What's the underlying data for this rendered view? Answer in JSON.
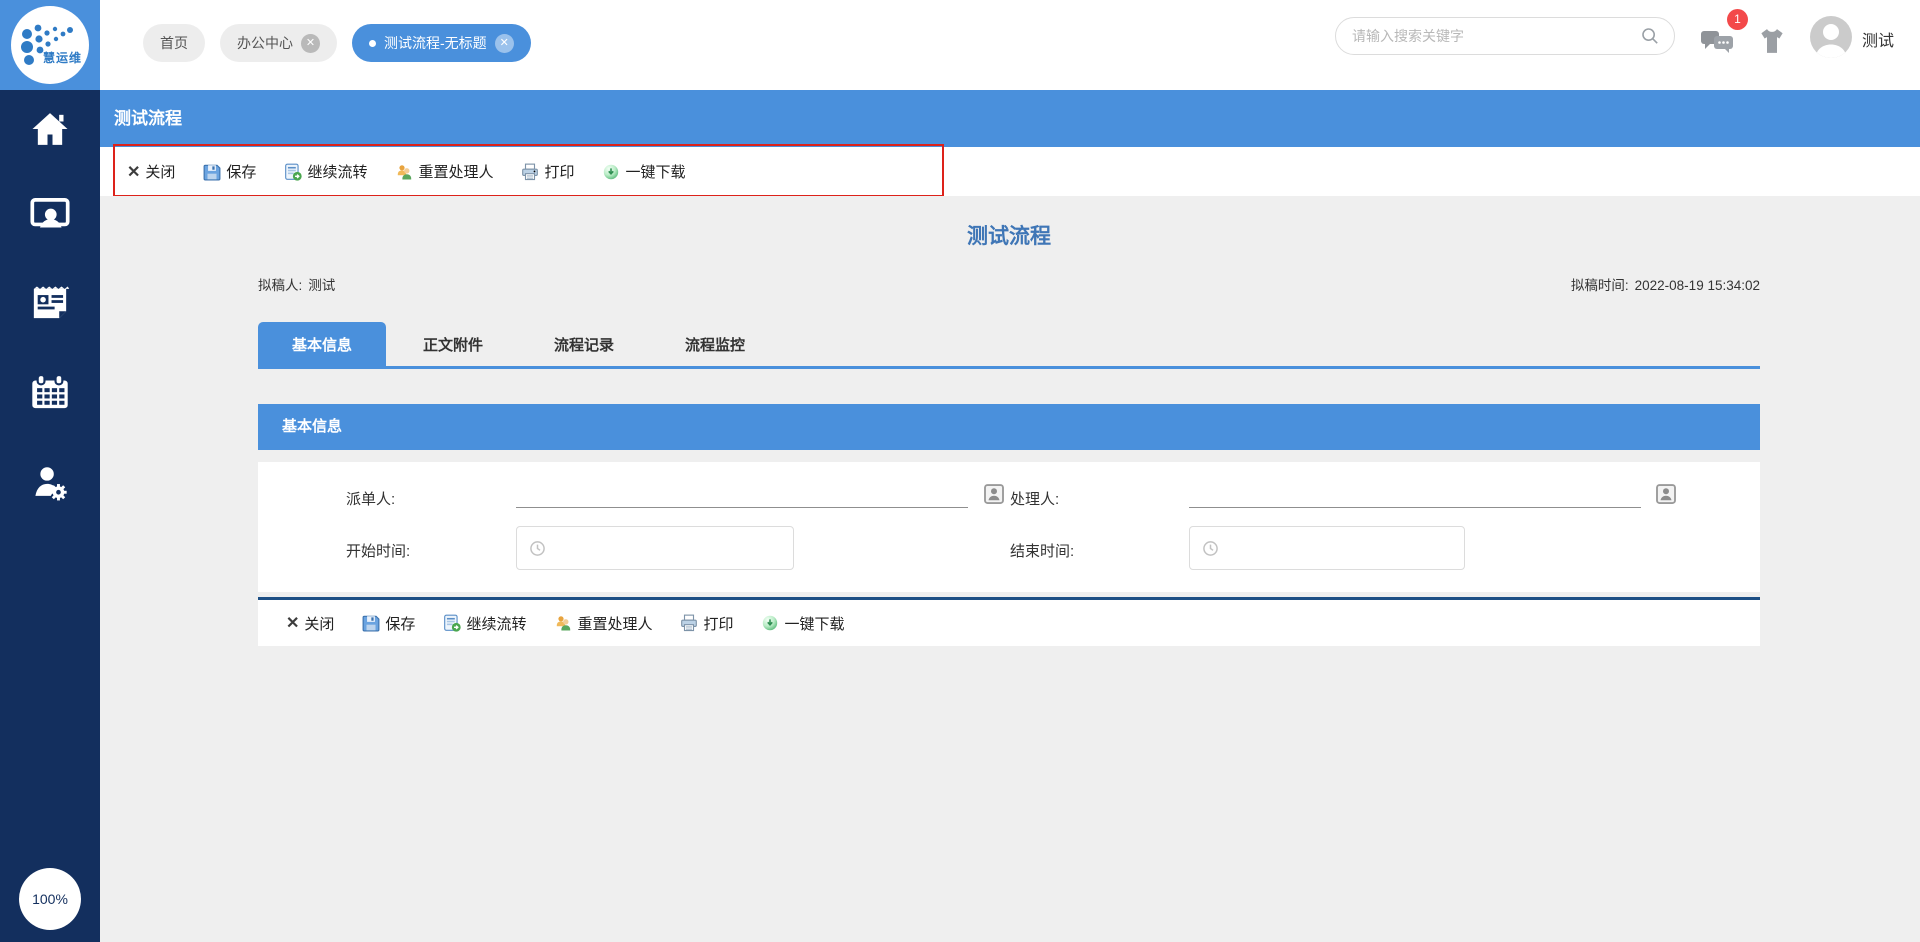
{
  "brand": {
    "name": "慧运维"
  },
  "topbar": {
    "tabs": [
      {
        "label": "首页",
        "closable": false,
        "active": false
      },
      {
        "label": "办公中心",
        "closable": true,
        "active": false
      },
      {
        "label": "测试流程-无标题",
        "closable": true,
        "active": true
      }
    ],
    "search_placeholder": "请输入搜索关键字",
    "search_icon": "search-icon",
    "notification_count": "1",
    "notification_icon": "chat-bubbles-icon",
    "theme_icon": "shirt-icon",
    "user_name": "测试"
  },
  "sidebar": {
    "items": [
      {
        "icon": "home-icon"
      },
      {
        "icon": "monitor-user-icon"
      },
      {
        "icon": "newspaper-icon"
      },
      {
        "icon": "calendar-icon"
      },
      {
        "icon": "user-gear-icon"
      }
    ],
    "zoom_level": "100%"
  },
  "page": {
    "header_title": "测试流程",
    "form_title": "测试流程",
    "drafter_label": "拟稿人:",
    "drafter_value": "测试",
    "draft_time_label": "拟稿时间:",
    "draft_time_value": "2022-08-19 15:34:02"
  },
  "toolbar": {
    "buttons": [
      {
        "label": "关闭",
        "icon": "close-x-icon"
      },
      {
        "label": "保存",
        "icon": "save-icon"
      },
      {
        "label": "继续流转",
        "icon": "continue-flow-icon"
      },
      {
        "label": "重置处理人",
        "icon": "reset-handler-icon"
      },
      {
        "label": "打印",
        "icon": "print-icon"
      },
      {
        "label": "一键下载",
        "icon": "download-icon"
      }
    ]
  },
  "content_tabs": [
    {
      "label": "基本信息",
      "active": true
    },
    {
      "label": "正文附件",
      "active": false
    },
    {
      "label": "流程记录",
      "active": false
    },
    {
      "label": "流程监控",
      "active": false
    }
  ],
  "form": {
    "section_title": "基本信息",
    "fields": [
      {
        "label": "派单人:",
        "value": "",
        "picker_icon": "person-picker-icon"
      },
      {
        "label": "处理人:",
        "value": "",
        "picker_icon": "person-picker-icon"
      },
      {
        "label": "开始时间:",
        "value": "",
        "picker_icon": "clock-icon"
      },
      {
        "label": "结束时间:",
        "value": "",
        "picker_icon": "clock-icon"
      }
    ]
  },
  "colors": {
    "primary_blue": "#4a90dc",
    "sidebar_navy": "#132f5e",
    "title_blue": "#3f76b6",
    "annotation_red": "#dd221a",
    "badge_red": "#f3494a",
    "divider_navy": "#1d4f85",
    "content_bg": "#efefef"
  }
}
